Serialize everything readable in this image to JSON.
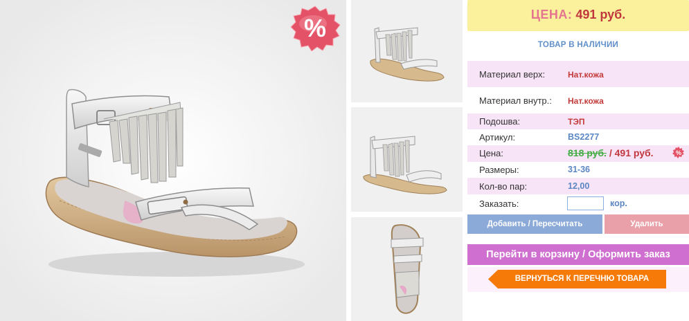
{
  "colors": {
    "accent_pink": "#cf6fd0",
    "price_red": "#c1373e",
    "link_blue": "#5a86c2",
    "header_yellow": "#fbf19c",
    "row_pink": "#f8e4f7",
    "button_blue": "#8caad8",
    "button_rose": "#eaa0a8",
    "back_orange": "#f57a08",
    "old_price_green": "#43ad43"
  },
  "badge": {
    "icon": "percent-sale-badge",
    "symbol": "%"
  },
  "header": {
    "label": "ЦЕНА:",
    "price": "491 руб."
  },
  "stock": {
    "text": "ТОВАР В НАЛИЧИИ"
  },
  "specs": {
    "material_top": {
      "label": "Материал верх:",
      "value": "Нат.кожа"
    },
    "material_inner": {
      "label": "Материал внутр.:",
      "value": "Нат.кожа"
    },
    "sole": {
      "label": "Подошва:",
      "value": "ТЭП"
    },
    "article": {
      "label": "Артикул:",
      "value": "BS2277"
    },
    "price": {
      "label": "Цена:",
      "old": "818 руб.",
      "new": "/ 491 руб.",
      "icon": "percent-icon"
    },
    "sizes": {
      "label": "Размеры:",
      "value": "31-36"
    },
    "pairs": {
      "label": "Кол-во пар:",
      "value": "12,00"
    },
    "order": {
      "label": "Заказать:",
      "quantity": "",
      "unit": "кор."
    }
  },
  "buttons": {
    "add": "Добавить / Пересчитать",
    "delete": "Удалить",
    "cart": "Перейти в корзину / Оформить заказ",
    "back": "ВЕРНУТЬСЯ К ПЕРЕЧНЮ ТОВАРА"
  }
}
